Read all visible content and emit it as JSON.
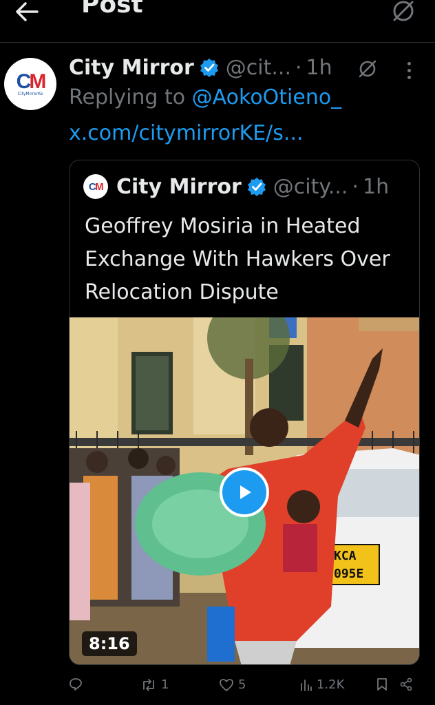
{
  "topbar": {
    "title": "Post",
    "back_icon": "arrow-left-icon",
    "grok_icon": "grok-icon"
  },
  "tweet": {
    "author_name": "City Mirror",
    "handle": "@cit...",
    "separator": "·",
    "time": "1h",
    "avatar_initials": "CM",
    "avatar_tagline": "CityMirrorKe",
    "replying_prefix": "Replying to ",
    "replying_to": "@AokoOtieno_",
    "link": "x.com/citymirrorKE/s...",
    "verified_icon": "verified-badge-icon"
  },
  "quote": {
    "author_name": "City Mirror",
    "handle": "@city...",
    "separator": "·",
    "time": "1h",
    "text": "Geoffrey Mosiria in Heated Exchange With Hawkers Over Relocation Dispute",
    "video": {
      "duration": "8:16",
      "plate_line1": "KCA",
      "plate_line2": "095E"
    }
  },
  "actions": {
    "replies": "",
    "reposts": "1",
    "likes": "5",
    "views": "1.2K"
  },
  "colors": {
    "background": "#000000",
    "text_primary": "#e7e9ea",
    "text_secondary": "#71767b",
    "accent": "#1d9bf0",
    "border": "#2f3336"
  }
}
